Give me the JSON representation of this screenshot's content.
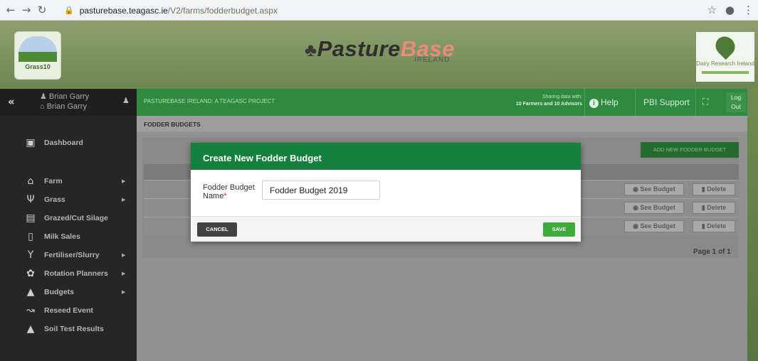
{
  "browser": {
    "back_icon": "arrow-left-icon",
    "url_host": "pasturebase.teagasc.ie",
    "url_path": "/V2/farms/fodderbudget.aspx"
  },
  "header": {
    "grass_logo_text": "Grass10",
    "pasturebase_part1": "Pasture",
    "pasturebase_part2": "Base",
    "pasturebase_sub": "IRELAND",
    "dri_text": "Dairy Research Ireland"
  },
  "user": {
    "line1": "Brian Garry",
    "line2": "Brian Garry"
  },
  "sidebar": {
    "dashboard": "Dashboard",
    "items": [
      {
        "label": "Farm",
        "icon": "home-icon",
        "has_submenu": true
      },
      {
        "label": "Grass",
        "icon": "grass-icon",
        "has_submenu": true
      },
      {
        "label": "Grazed/Cut Silage",
        "icon": "silage-icon",
        "has_submenu": false
      },
      {
        "label": "Milk Sales",
        "icon": "milk-icon",
        "has_submenu": false
      },
      {
        "label": "Fertiliser/Slurry",
        "icon": "fertiliser-icon",
        "has_submenu": true
      },
      {
        "label": "Rotation Planners",
        "icon": "rotation-icon",
        "has_submenu": true
      },
      {
        "label": "Budgets",
        "icon": "budgets-icon",
        "has_submenu": true
      },
      {
        "label": "Reseed Event",
        "icon": "reseed-icon",
        "has_submenu": false
      },
      {
        "label": "Soil Test Results",
        "icon": "soil-icon",
        "has_submenu": false
      }
    ]
  },
  "topbar": {
    "title": "PASTUREBASE IRELAND: A TEAGASC PROJECT",
    "share_line1": "Sharing data with:",
    "share_line2": "10 Farmers and 10 Advisors",
    "help": "Help",
    "support": "PBI Support",
    "logout_line1": "Log",
    "logout_line2": "Out"
  },
  "page": {
    "breadcrumb": "FODDER BUDGETS",
    "add_button": "ADD NEW FODDER BUDGET",
    "see_budget": "See Budget",
    "delete": "Delete",
    "pager": "Page 1 of 1"
  },
  "modal": {
    "title": "Create New Fodder Budget",
    "label_line1": "Fodder Budget",
    "label_line2": "Name",
    "required_mark": "*",
    "input_value": "Fodder Budget 2019",
    "cancel": "CANCEL",
    "save": "SAVE"
  },
  "colors": {
    "brand_green": "#15803d",
    "save_green": "#3caa3c",
    "topbar_green": "#2e8a3e",
    "sidebar_dark": "#262626"
  }
}
